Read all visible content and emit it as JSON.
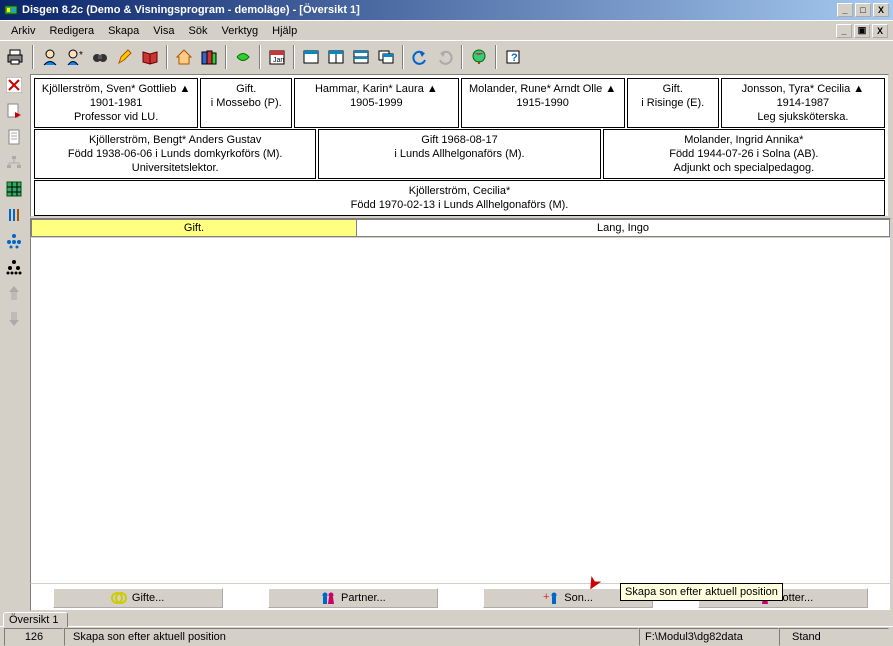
{
  "title": "Disgen 8.2c (Demo & Visningsprogram - demoläge) - [Översikt 1]",
  "menus": [
    "Arkiv",
    "Redigera",
    "Skapa",
    "Visa",
    "Sök",
    "Verktyg",
    "Hjälp"
  ],
  "grand": [
    {
      "name": "Kjöllerström, Sven* Gottlieb ▲",
      "years": "1901-1981",
      "note": "Professor vid LU."
    },
    {
      "name": "Gift.",
      "years": "i Mossebo (P).",
      "note": ""
    },
    {
      "name": "Hammar, Karin* Laura ▲",
      "years": "1905-1999",
      "note": ""
    },
    {
      "name": "Molander, Rune* Arndt Olle ▲",
      "years": "1915-1990",
      "note": ""
    },
    {
      "name": "Gift.",
      "years": "i Risinge (E).",
      "note": ""
    },
    {
      "name": "Jonsson, Tyra* Cecilia ▲",
      "years": "1914-1987",
      "note": "Leg sjuksköterska."
    }
  ],
  "parents": [
    {
      "name": "Kjöllerström, Bengt* Anders Gustav",
      "born": "Född 1938-06-06 i Lunds domkyrkoförs (M).",
      "note": "Universitetslektor."
    },
    {
      "name": "Gift 1968-08-17",
      "born": "i Lunds Allhelgonaförs (M).",
      "note": ""
    },
    {
      "name": "Molander, Ingrid Annika*",
      "born": "Född 1944-07-26 i Solna (AB).",
      "note": "Adjunkt och specialpedagog."
    }
  ],
  "center": {
    "name": "Kjöllerström, Cecilia*",
    "born": "Född 1970-02-13 i Lunds Allhelgonaförs (M)."
  },
  "rel": {
    "status": "Gift.",
    "partner": "Lang, Ingo"
  },
  "buttons": {
    "gifte": "Gifte...",
    "partner": "Partner...",
    "son": "Son...",
    "dotter": "Dotter..."
  },
  "tab": "Översikt 1",
  "status": {
    "num": "126",
    "msg": "Skapa son efter aktuell position",
    "path": "F:\\Modul3\\dg82data",
    "mode": "Stand"
  },
  "tooltip": "Skapa son efter aktuell position"
}
